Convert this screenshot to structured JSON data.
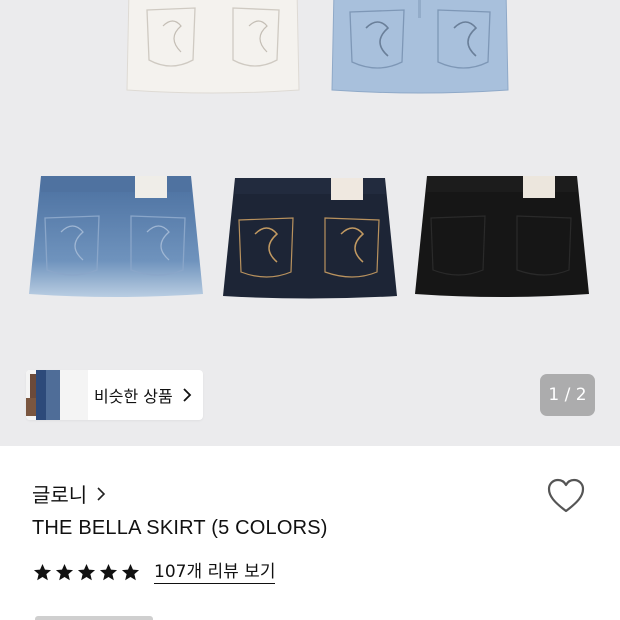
{
  "gallery": {
    "similar_label": "비슷한 상품",
    "pager": "1 / 2",
    "products": [
      {
        "color": "#f2f0ec"
      },
      {
        "color": "#a9c1dd"
      },
      {
        "color": "#5579a5"
      },
      {
        "color": "#1d2535"
      },
      {
        "color": "#161616"
      }
    ]
  },
  "product": {
    "brand": "글로니",
    "title": "THE BELLA SKIRT (5 COLORS)",
    "rating": 5,
    "review_link": "107개 리뷰 보기"
  },
  "colors": {
    "gallery_bg": "#ebebed",
    "star": "#111111"
  }
}
